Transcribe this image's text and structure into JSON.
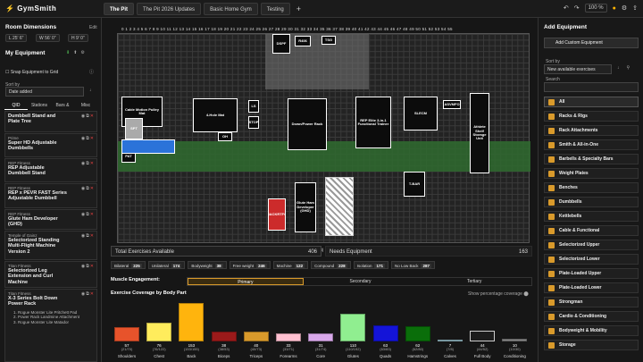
{
  "app": {
    "logo": "GymSmith",
    "zoom": "100 %"
  },
  "tabs": [
    "The Pit",
    "The Pit 2026 Updates",
    "Basic Home Gym",
    "Testing"
  ],
  "room": {
    "title": "Room Dimensions",
    "edit": "Edit",
    "length": "25' 6\"",
    "width": "56' 0\"",
    "height": "9' 0\""
  },
  "my_equipment": {
    "title": "My Equipment",
    "snap": "Snap Equipment to Grid",
    "sort_label": "Sort by",
    "sort_value": "Date added",
    "subtabs": [
      "QID",
      "Stations",
      "Bars & Bells",
      "Misc"
    ],
    "items": [
      {
        "brand": "",
        "name": "Dumbbell Stand and Plate Tree"
      },
      {
        "brand": "Prime",
        "name": "Super HD Adjustable Dumbbells"
      },
      {
        "brand": "REP Fitness",
        "name": "REP Adjustable Dumbbell Stand"
      },
      {
        "brand": "REP Fitness",
        "name": "REP x PEVR FAST Series Adjustable Dumbbell"
      },
      {
        "brand": "REP Fitness",
        "name": "Glute Ham Developer (GHD)"
      },
      {
        "brand": "Temple of Gainz",
        "name": "Selectorized Standing Multi-Flight Machine Version 2"
      },
      {
        "brand": "Titan Fitness",
        "name": "Selectorized Leg Extension and Curl Machine"
      },
      {
        "brand": "Titan Fitness",
        "name": "X-3 Series Bolt Down Power Rack"
      }
    ],
    "subitems": [
      "1. Rogue Monster Lite Pritchett Pad",
      "2. Power Rack Landmine Attachment",
      "3. Rogue Monster Lite Matador"
    ]
  },
  "canvas": {
    "width_label": "Width (ft)",
    "length_label": "Length (ft)",
    "equipment": [
      {
        "label": "DSPF"
      },
      {
        "label": "R406"
      },
      {
        "label": "TSG"
      },
      {
        "label": "Cable Motion Pulley Mat"
      },
      {
        "label": "4-Hole Mat"
      },
      {
        "label": "LS"
      },
      {
        "label": "STOP"
      },
      {
        "label": "OH"
      },
      {
        "label": "Down/Power Rack"
      },
      {
        "label": "REP Elite 3-in-1 Functional Trainer"
      },
      {
        "label": "SLECM"
      },
      {
        "label": "ASVMFO"
      },
      {
        "label": "Athlete Shelf Storage Unit"
      },
      {
        "label": "T-BAR"
      },
      {
        "label": "HACKRTFO"
      },
      {
        "label": "Glute Ham Developer (GHD)"
      },
      {
        "label": "PAT"
      },
      {
        "label": "SPT"
      }
    ]
  },
  "stats": {
    "total_label": "Total Exercises Available",
    "total": "406",
    "needs_label": "Needs Equipment",
    "needs": "163",
    "chips": [
      {
        "label": "Bilateral",
        "value": "225"
      },
      {
        "label": "Unilateral",
        "value": "174"
      },
      {
        "label": "Bodyweight",
        "value": "38"
      },
      {
        "label": "Free weight",
        "value": "246"
      },
      {
        "label": "Machine",
        "value": "122"
      },
      {
        "label": "Compound",
        "value": "228"
      },
      {
        "label": "Isolation",
        "value": "171"
      },
      {
        "label": "No Low Back",
        "value": "287"
      }
    ],
    "engagement_label": "Muscle Engagement:",
    "engagement_tabs": [
      "Primary",
      "Secondary",
      "Tertiary"
    ],
    "coverage_title": "Exercise Coverage by Body Part",
    "pct_toggle": "Show percentage coverage"
  },
  "chart_data": {
    "type": "bar",
    "title": "Exercise Coverage by Body Part",
    "categories": [
      "Shoulders",
      "Chest",
      "Back",
      "Biceps",
      "Triceps",
      "Forearms",
      "Core",
      "Glutes",
      "Quads",
      "Hamstrings",
      "Calves",
      "Full Body",
      "Conditioning"
    ],
    "values": [
      57,
      76,
      153,
      38,
      40,
      33,
      31,
      110,
      63,
      62,
      7,
      44,
      10
    ],
    "totals": [
      "21/70",
      "76/122",
      "153/155",
      "38/53",
      "40/73",
      "33/71",
      "31/74",
      "110/192",
      "63/83",
      "62/80",
      "7/8",
      "44/52",
      "10/30"
    ],
    "colors": [
      "#e7532b",
      "#ffec5c",
      "#ffb40d",
      "#9b1a1a",
      "#d99a2b",
      "#ffc0d0",
      "#d8a8ea",
      "#90ee90",
      "#1414d8",
      "#0a6e0a",
      "#add8e6",
      "#1c1c1c",
      "#888888"
    ]
  },
  "add_equipment": {
    "title": "Add Equipment",
    "custom": "Add Custom Equipment",
    "sort_label": "Sort by",
    "sort_value": "New available exercises",
    "search_label": "Search",
    "categories": [
      "All",
      "Racks & Rigs",
      "Rack Attachments",
      "Smith & All-in-One",
      "Barbells & Specialty Bars",
      "Weight Plates",
      "Benches",
      "Dumbbells",
      "Kettlebells",
      "Cable & Functional",
      "Selectorized Upper",
      "Selectorized Lower",
      "Plate-Loaded Upper",
      "Plate-Loaded Lower",
      "Strongman",
      "Cardio & Conditioning",
      "Bodyweight & Mobility",
      "Storage"
    ]
  }
}
